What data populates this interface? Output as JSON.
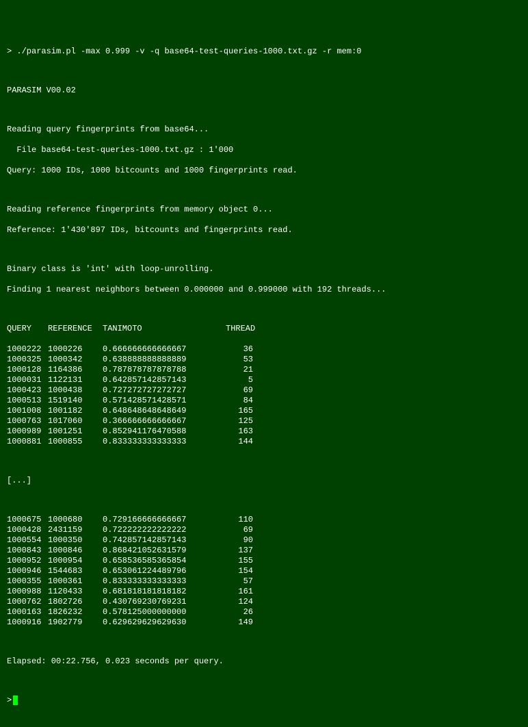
{
  "cmd": "> ./parasim.pl -max 0.999 -v -q base64-test-queries-1000.txt.gz -r mem:0",
  "version": "PARASIM V00.02",
  "read_q1": "Reading query fingerprints from base64...",
  "read_q2": "  File base64-test-queries-1000.txt.gz : 1'000",
  "read_q3": "Query: 1000 IDs, 1000 bitcounts and 1000 fingerprints read.",
  "read_r1": "Reading reference fingerprints from memory object 0...",
  "read_r2": "Reference: 1'430'897 IDs, bitcounts and fingerprints read.",
  "binclass": "Binary class is 'int' with loop-unrolling.",
  "finding": "Finding 1 nearest neighbors between 0.000000 and 0.999000 with 192 threads...",
  "hdr": {
    "q": "QUERY",
    "r": "REFERENCE",
    "t": "TANIMOTO",
    "th": "THREAD"
  },
  "rows1": [
    {
      "q": "1000222",
      "r": "1000226",
      "t": "0.666666666666667",
      "th": "36"
    },
    {
      "q": "1000325",
      "r": "1000342",
      "t": "0.638888888888889",
      "th": "53"
    },
    {
      "q": "1000128",
      "r": "1164386",
      "t": "0.787878787878788",
      "th": "21"
    },
    {
      "q": "1000031",
      "r": "1122131",
      "t": "0.642857142857143",
      "th": "5"
    },
    {
      "q": "1000423",
      "r": "1000438",
      "t": "0.727272727272727",
      "th": "69"
    },
    {
      "q": "1000513",
      "r": "1519140",
      "t": "0.571428571428571",
      "th": "84"
    },
    {
      "q": "1001008",
      "r": "1001182",
      "t": "0.648648648648649",
      "th": "165"
    },
    {
      "q": "1000763",
      "r": "1017060",
      "t": "0.366666666666667",
      "th": "125"
    },
    {
      "q": "1000989",
      "r": "1001251",
      "t": "0.852941176470588",
      "th": "163"
    },
    {
      "q": "1000881",
      "r": "1000855",
      "t": "0.833333333333333",
      "th": "144"
    }
  ],
  "ellipsis": "[...]",
  "rows2": [
    {
      "q": "1000675",
      "r": "1000680",
      "t": "0.729166666666667",
      "th": "110"
    },
    {
      "q": "1000428",
      "r": "2431159",
      "t": "0.722222222222222",
      "th": "69"
    },
    {
      "q": "1000554",
      "r": "1000350",
      "t": "0.742857142857143",
      "th": "90"
    },
    {
      "q": "1000843",
      "r": "1000846",
      "t": "0.868421052631579",
      "th": "137"
    },
    {
      "q": "1000952",
      "r": "1000954",
      "t": "0.658536585365854",
      "th": "155"
    },
    {
      "q": "1000946",
      "r": "1544683",
      "t": "0.653061224489796",
      "th": "154"
    },
    {
      "q": "1000355",
      "r": "1000361",
      "t": "0.833333333333333",
      "th": "57"
    },
    {
      "q": "1000988",
      "r": "1120433",
      "t": "0.681818181818182",
      "th": "161"
    },
    {
      "q": "1000762",
      "r": "1802726",
      "t": "0.430769230769231",
      "th": "124"
    },
    {
      "q": "1000163",
      "r": "1826232",
      "t": "0.578125000000000",
      "th": "26"
    },
    {
      "q": "1000916",
      "r": "1902779",
      "t": "0.629629629629630",
      "th": "149"
    }
  ],
  "elapsed": "Elapsed: 00:22.756, 0.023 seconds per query.",
  "prompt": ">"
}
